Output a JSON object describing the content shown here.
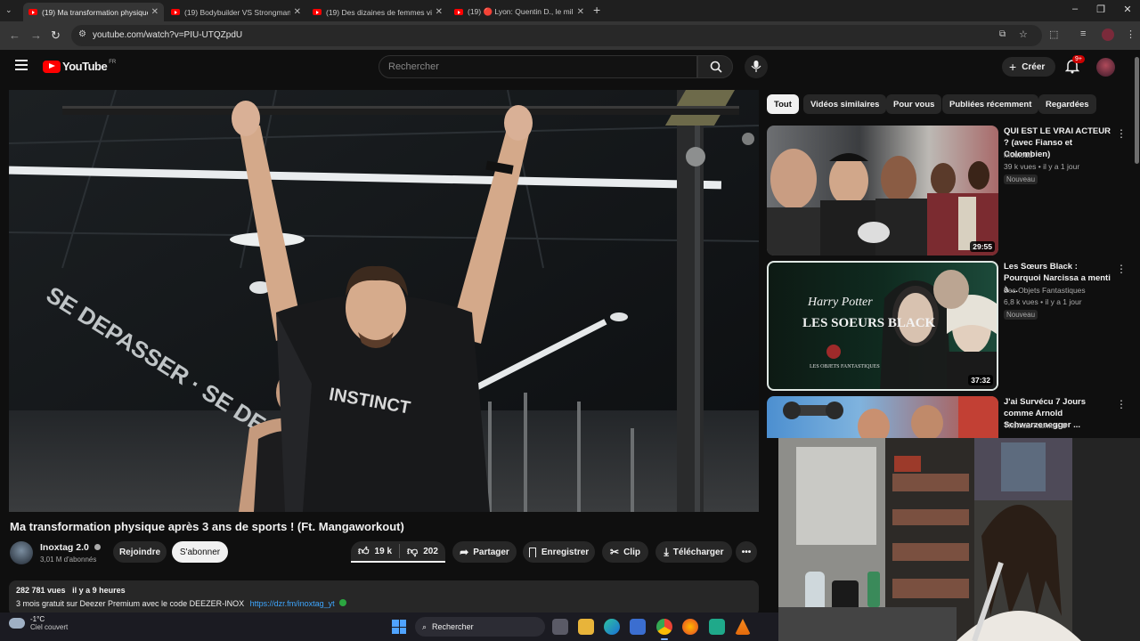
{
  "browser": {
    "tabs": [
      {
        "title": "(19) Ma transformation physique",
        "active": true
      },
      {
        "title": "(19) Bodybuilder VS Strongman",
        "active": false
      },
      {
        "title": "(19) Des dizaines de femmes vi",
        "active": false
      },
      {
        "title": "(19) 🔴 Lyon: Quentin D., le mil",
        "active": false
      }
    ],
    "url": "youtube.com/watch?v=PIU-UTQZpdU"
  },
  "youtube": {
    "logo_text": "YouTube",
    "region": "FR",
    "search_placeholder": "Rechercher",
    "create_label": "Créer",
    "notif_count": "9+"
  },
  "video": {
    "title": "Ma transformation physique après 3 ans de sports ! (Ft. Mangaworkout)",
    "channel": "Inoxtag 2.0",
    "subscribers": "3,01 M d'abonnés",
    "join_label": "Rejoindre",
    "subscribe_label": "S'abonner",
    "likes": "19 k",
    "dislikes": "202",
    "share_label": "Partager",
    "save_label": "Enregistrer",
    "clip_label": "Clip",
    "download_label": "Télécharger",
    "views": "282 781 vues",
    "age": "il y a 9 heures",
    "desc_line": "3 mois gratuit sur Deezer Premium avec le code DEEZER-INOX",
    "desc_link": "https://dzr.fm/inoxtag_yt",
    "shirt_text": "INSTINCT"
  },
  "filters": [
    "Tout",
    "Vidéos similaires",
    "Pour vous",
    "Publiées récemment",
    "Regardées"
  ],
  "recommendations": [
    {
      "title": "QUI EST LE VRAI ACTEUR ? (avec Fianso et Colombien)",
      "channel": "Mouloud",
      "meta": "39 k vues • il y a 1 jour",
      "badge": "Nouveau",
      "duration": "29:55"
    },
    {
      "title": "Les Sœurs Black : Pourquoi Narcissa a menti à ...",
      "channel": "Les Objets Fantastiques",
      "meta": "6,8 k vues • il y a 1 jour",
      "badge": "Nouveau",
      "duration": "37:32",
      "thumb_top": "Harry Potter",
      "thumb_main": "LES SOEURS BLACK",
      "thumb_sub": "LES OBJETS FANTASTIQUES"
    },
    {
      "title": "J'ai Survécu 7 Jours comme Arnold Schwarzenegger ...",
      "channel": "Thomas Rainieri",
      "meta": "",
      "badge": "",
      "duration": ""
    }
  ],
  "taskbar": {
    "weather_temp": "-1°C",
    "weather_desc": "Ciel couvert",
    "search_label": "Rechercher"
  }
}
